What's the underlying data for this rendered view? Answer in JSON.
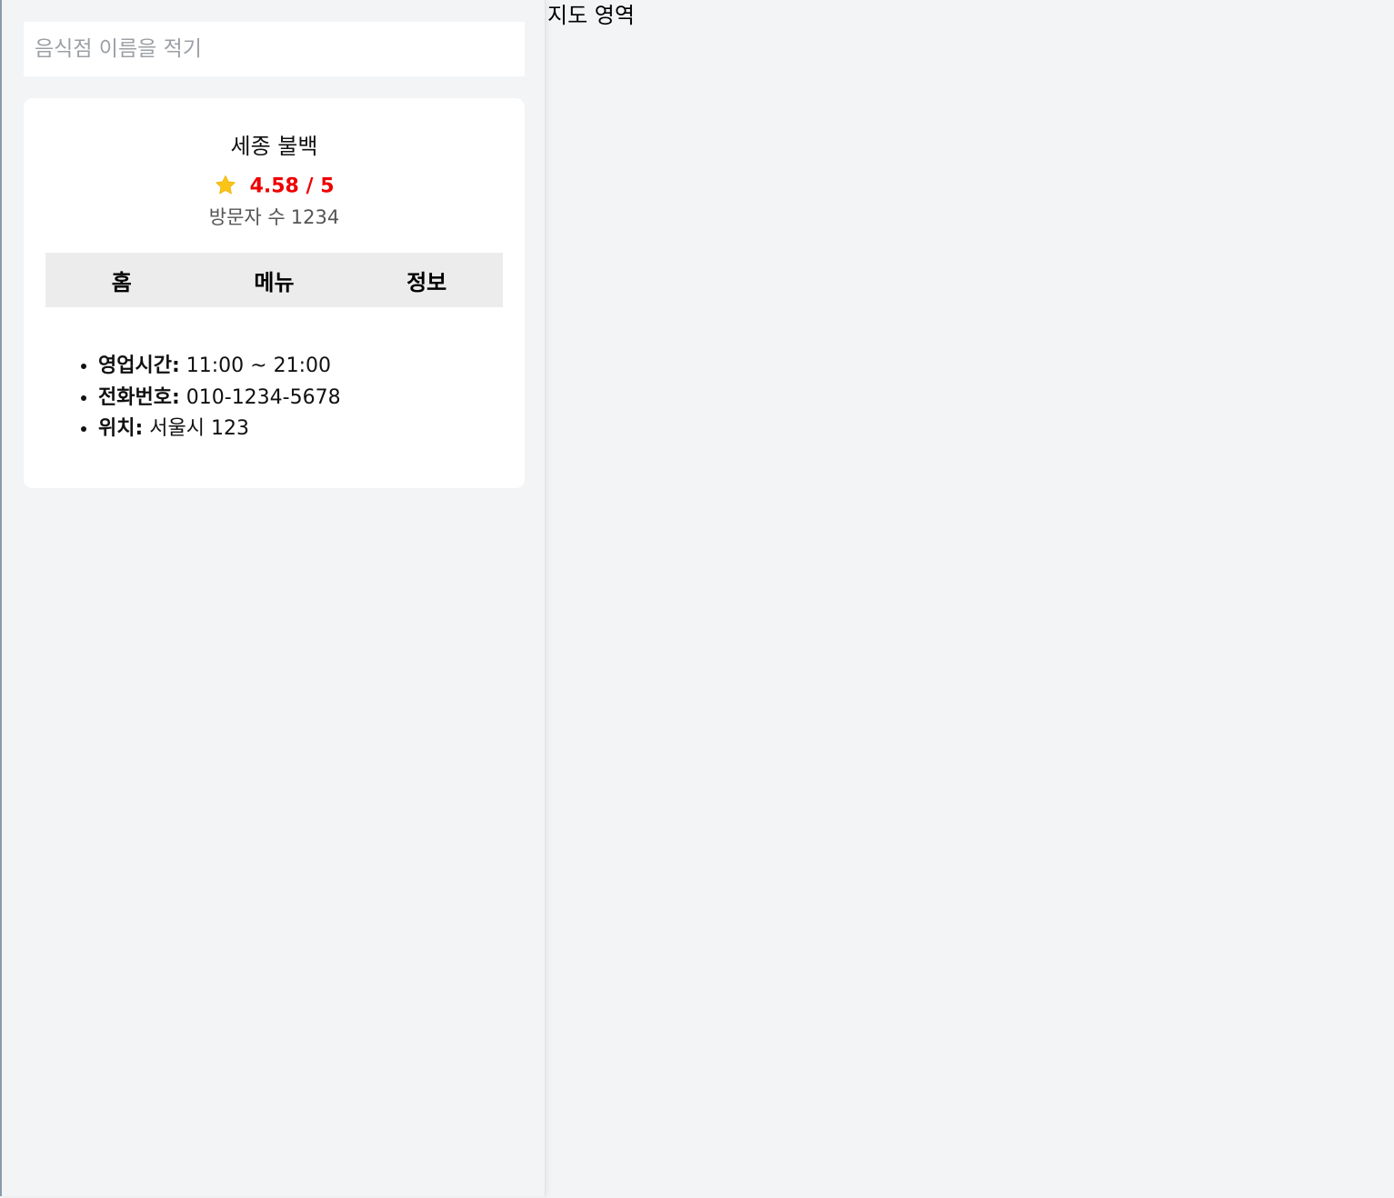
{
  "search": {
    "placeholder": "음식점 이름을 적기",
    "value": ""
  },
  "restaurant": {
    "name": "세종 불백",
    "rating": "4.58 / 5",
    "visitors_label": "방문자 수",
    "visitors_count": "1234",
    "star_icon": "star-icon",
    "star_color": "#fcc419",
    "rating_color": "#ee0000"
  },
  "tabs": [
    {
      "label": "홈"
    },
    {
      "label": "메뉴"
    },
    {
      "label": "정보"
    }
  ],
  "info": [
    {
      "label": "영업시간:",
      "value": " 11:00 ~ 21:00"
    },
    {
      "label": "전화번호:",
      "value": " 010-1234-5678"
    },
    {
      "label": "위치:",
      "value": " 서울시 123"
    }
  ],
  "map": {
    "label": "지도 영역"
  }
}
